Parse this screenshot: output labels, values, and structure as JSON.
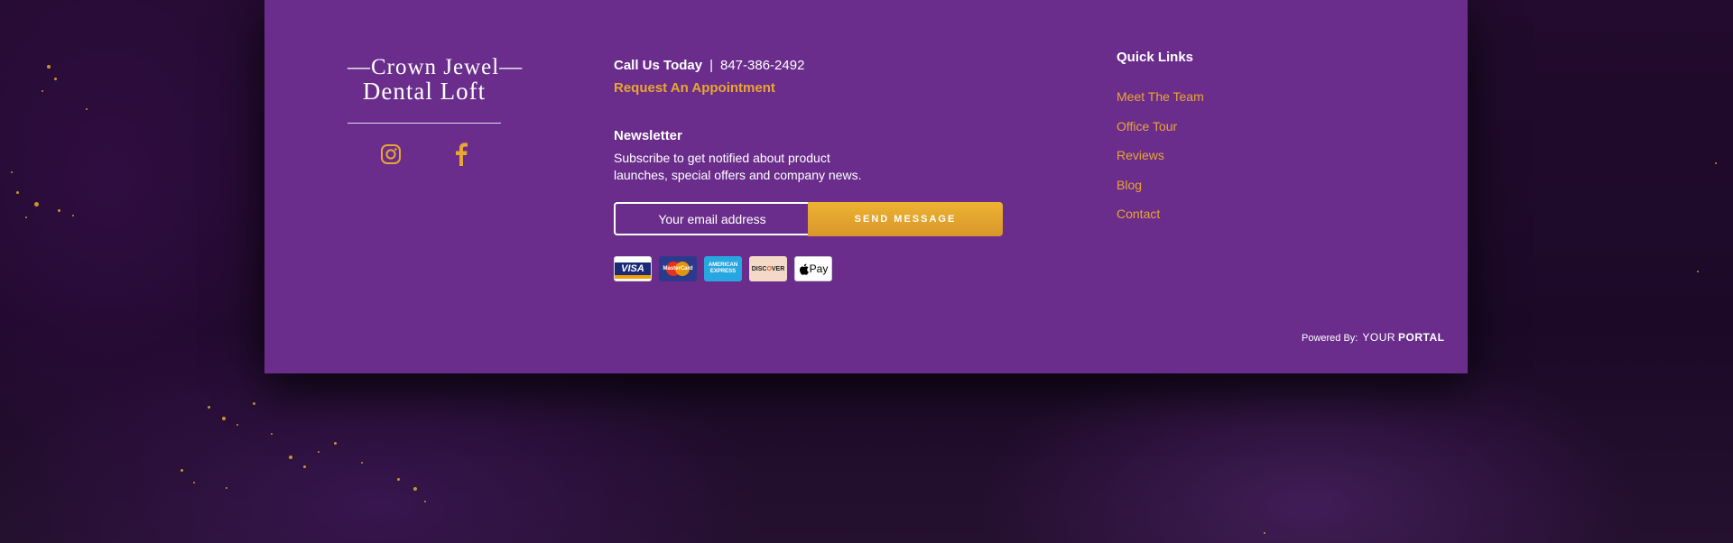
{
  "brand": {
    "logo_line1": "—Crown Jewel—",
    "logo_line2": "Dental Loft",
    "accent_color": "#e8a632",
    "footer_bg": "#6a2d8c"
  },
  "social": {
    "instagram_icon": "instagram-icon",
    "facebook_icon": "facebook-icon"
  },
  "contact": {
    "call_label": "Call Us Today",
    "separator": "|",
    "phone": "847-386-2492",
    "appointment_link": "Request An Appointment"
  },
  "newsletter": {
    "title": "Newsletter",
    "description": "Subscribe to get notified about product launches, special offers and company news.",
    "email_placeholder": "Your email address",
    "submit_label": "SEND MESSAGE"
  },
  "payments": {
    "visa": "VISA",
    "mastercard": "MasterCard",
    "amex": "AMERICAN EXPRESS",
    "discover_pre": "DISC",
    "discover_o": "O",
    "discover_post": "VER",
    "applepay": "Pay"
  },
  "quick_links": {
    "title": "Quick Links",
    "items": [
      "Meet The Team",
      "Office Tour",
      "Reviews",
      "Blog",
      "Contact"
    ]
  },
  "powered": {
    "label": "Powered By:",
    "brand_your": "YOUR",
    "brand_portal": "PORTAL"
  }
}
